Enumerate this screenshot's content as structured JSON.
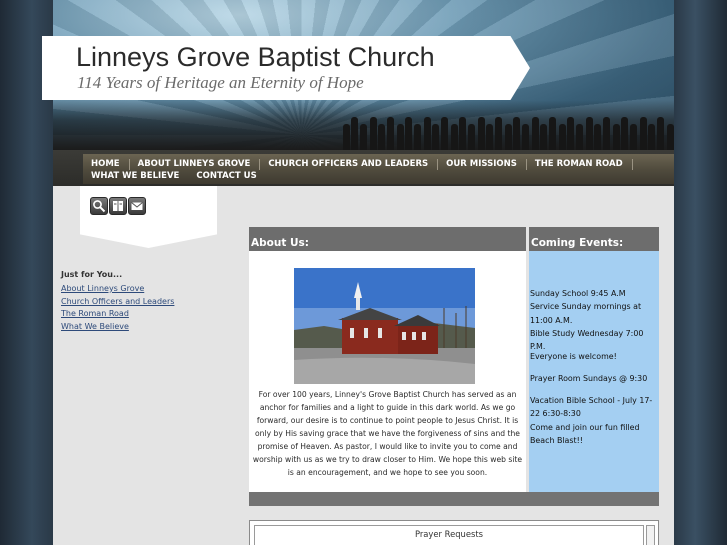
{
  "site": {
    "title": "Linneys Grove Baptist Church",
    "tagline": "114 Years of Heritage an Eternity of Hope"
  },
  "nav": {
    "items": [
      {
        "label": "HOME"
      },
      {
        "label": "ABOUT LINNEYS GROVE"
      },
      {
        "label": "CHURCH OFFICERS AND LEADERS"
      },
      {
        "label": "OUR MISSIONS"
      },
      {
        "label": "THE ROMAN ROAD"
      },
      {
        "label": "WHAT WE BELIEVE"
      },
      {
        "label": "CONTACT US"
      }
    ]
  },
  "toolbar": {
    "icons": [
      "search-icon",
      "book-icon",
      "mail-icon"
    ]
  },
  "sidebar": {
    "heading": "Just for You...",
    "links": [
      {
        "label": "About Linneys Grove"
      },
      {
        "label": "Church Officers and Leaders"
      },
      {
        "label": "The Roman Road"
      },
      {
        "label": "What We Believe"
      }
    ]
  },
  "about": {
    "heading": "About Us:",
    "text": "For over 100 years, Linney's Grove Baptist Church has served as an anchor for families and a light to guide in this dark world. As we go forward, our desire is to continue to point people to Jesus Christ. It is only by His saving grace that we have the forgiveness of sins and the promise of Heaven. As pastor, I would like to invite you to come and worship with us as we try to draw closer to Him. We hope this web site is an encouragement, and we hope to see you soon."
  },
  "events": {
    "heading": "Coming Events:",
    "lines": {
      "sunday_school": "Sunday School 9:45 A.M",
      "service": "Service Sunday mornings at 11:00 A.M.",
      "bible_study": "Bible Study Wednesday 7:00 P.M.",
      "welcome": "Everyone is welcome!",
      "prayer_room": "Prayer Room Sundays @ 9:30",
      "vbs": "Vacation Bible School - July 17-22 6:30-8:30",
      "vbs_join": "Come and join our fun filled Beach Blast!!"
    }
  },
  "prayer": {
    "label": "Prayer Requests"
  }
}
